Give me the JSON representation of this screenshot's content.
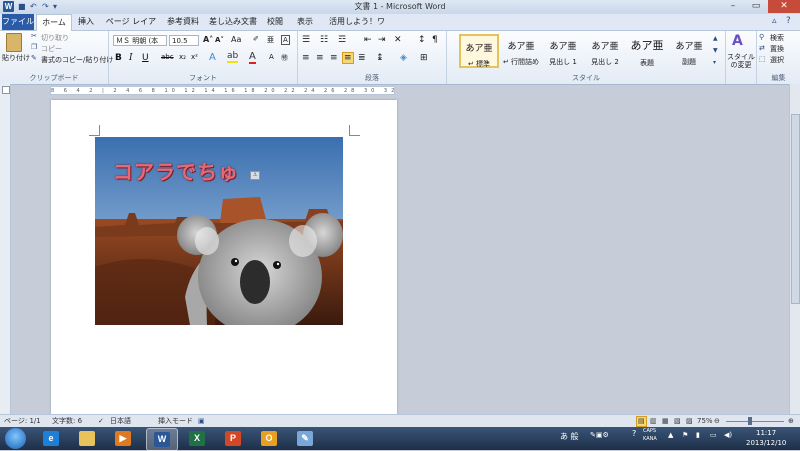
{
  "window": {
    "title": "文書 1 - Microsoft Word",
    "app_icon": "W"
  },
  "tabs": [
    "ファイル",
    "ホーム",
    "挿入",
    "ページ レイアウト",
    "参考資料",
    "差し込み文書",
    "校閲",
    "表示",
    "活用しよう！ワード"
  ],
  "ribbon": {
    "clipboard": {
      "paste": "貼り付け",
      "cut": "切り取り",
      "copy": "コピー",
      "format_painter": "書式のコピー/貼り付け",
      "label": "クリップボード"
    },
    "font": {
      "name": "ＭＳ 明朝 (本",
      "size": "10.5",
      "label": "フォント"
    },
    "paragraph": {
      "label": "段落"
    },
    "styles": {
      "label": "スタイル",
      "items": [
        {
          "preview": "あア亜",
          "name": "↵ 標準"
        },
        {
          "preview": "あア亜",
          "name": "↵ 行間詰め"
        },
        {
          "preview": "あア亜",
          "name": "見出し 1"
        },
        {
          "preview": "あア亜",
          "name": "見出し 2"
        },
        {
          "preview": "あア亜",
          "name": "表題"
        },
        {
          "preview": "あア亜",
          "name": "副題"
        }
      ],
      "change_styles": "スタイルの変更"
    },
    "editing": {
      "find": "検索",
      "replace": "置換",
      "select": "選択",
      "label": "編集"
    }
  },
  "ruler_numbers": "8 6 4 2 | 2 4 6 8 10 12 14 16 18 20 22 24 26 28 30 32 34 36 38 40 42 44 46 48",
  "document": {
    "wordart": "コアラでちゅ"
  },
  "statusbar": {
    "page": "ページ: 1/1",
    "words": "文字数: 6",
    "language": "日本語",
    "mode": "挿入モード",
    "zoom": "75%"
  },
  "taskbar": {
    "tray_ime": "あ 般",
    "time": "11:17",
    "date": "2013/12/10",
    "caps": "CAPS",
    "kana": "KANA"
  }
}
